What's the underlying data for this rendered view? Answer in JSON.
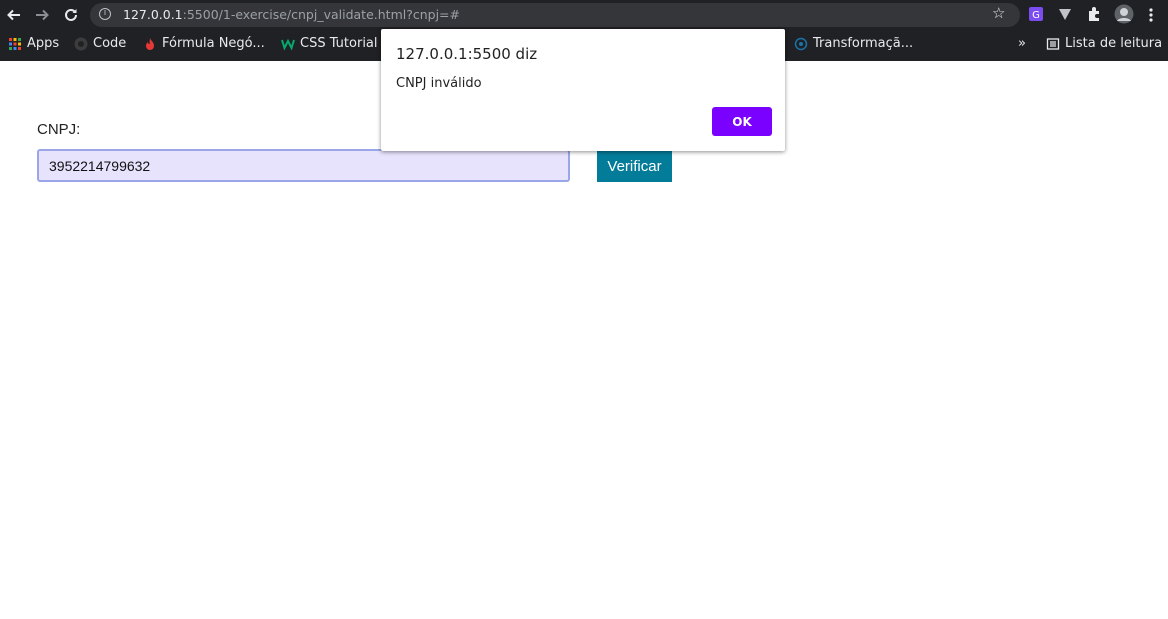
{
  "browser": {
    "url_host": "127.0.0.1",
    "url_rest": ":5500/1-exercise/cnpj_validate.html?cnpj=#",
    "bookmarks": [
      {
        "label": "Apps"
      },
      {
        "label": "Code"
      },
      {
        "label": "Fórmula Negó..."
      },
      {
        "label": "CSS Tutorial"
      },
      {
        "label": "Transformaçã..."
      }
    ],
    "more_bookmarks": "»",
    "reading_list": "Lista de leitura"
  },
  "form": {
    "label": "CNPJ:",
    "cnpj_value": "3952214799632",
    "verify_label": "Verificar"
  },
  "dialog": {
    "title": "127.0.0.1:5500 diz",
    "message": "CNPJ inválido",
    "ok_label": "OK"
  },
  "colors": {
    "accent_button": "#037c9a",
    "dialog_ok": "#7a00ff",
    "input_bg": "#e8e3fd"
  }
}
